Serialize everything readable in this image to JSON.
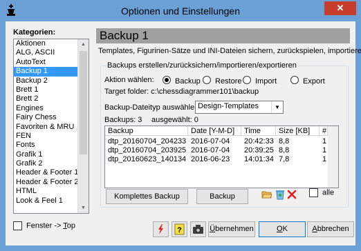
{
  "window": {
    "title": "Optionen und Einstellungen",
    "close_glyph": "✕"
  },
  "sidebar": {
    "label": "Kategorien:",
    "items": [
      "Aktionen",
      "ALG, ASCII",
      "AutoText",
      "Backup 1",
      "Backup 2",
      "Brett 1",
      "Brett 2",
      "Engines",
      "Fairy Chess",
      "Favoriten & MRU",
      "FEN",
      "Fonts",
      "Grafik 1",
      "Grafik 2",
      "Header & Footer 1",
      "Header & Footer 2",
      "HTML",
      "Look & Feel 1"
    ],
    "selected_index": 3,
    "fenster_top": {
      "prefix": "Fenster -> ",
      "underlined": "T",
      "suffix": "op"
    }
  },
  "main": {
    "title": "Backup 1",
    "subtitle": "Templates, Figurinen-Sätze und INI-Dateien sichern, zurückspielen, importieren,",
    "group_label": "Backups erstellen/zurücksichern/importieren/exportieren",
    "aktion_label": "Aktion wählen:",
    "radio_options": [
      {
        "label": "Backup",
        "checked": true
      },
      {
        "label": "Restore",
        "checked": false
      },
      {
        "label": "Import",
        "checked": false
      },
      {
        "label": "Export",
        "checked": false
      }
    ],
    "target_folder": "Target folder:  c:\\chessdiagrammer101\\backup",
    "dateityp_label": "Backup-Dateityp auswählen:",
    "dateityp_value": "Design-Templates",
    "backups_count": "Backups: 3",
    "ausgewaehlt": "ausgewählt: 0",
    "table": {
      "headers": [
        "Backup",
        "Date [Y-M-D]",
        "Time",
        "Size [KB]",
        "#"
      ],
      "rows": [
        [
          "dtp_20160704_204233",
          "2016-07-04",
          "20:42:33",
          "8,8",
          "1"
        ],
        [
          "dtp_20160704_203925",
          "2016-07-04",
          "20:39:25",
          "8,8",
          "1"
        ],
        [
          "dtp_20160623_140134",
          "2016-06-23",
          "14:01:34",
          "7,8",
          "1"
        ]
      ]
    },
    "komplettes_backup_label": "Komplettes Backup",
    "backup_button_label": "Backup",
    "alle_label": "alle"
  },
  "footer": {
    "uebernehmen": {
      "underlined": "Ü",
      "rest": "bernehmen"
    },
    "ok": {
      "underlined": "O",
      "rest": "K"
    },
    "abbrechen": {
      "underlined": "A",
      "rest": "bbrechen"
    }
  },
  "colors": {
    "titlebar": "#6ba1d6",
    "close": "#c73e2c",
    "selection": "#3399ff",
    "header_band": "#a0a0a0"
  }
}
